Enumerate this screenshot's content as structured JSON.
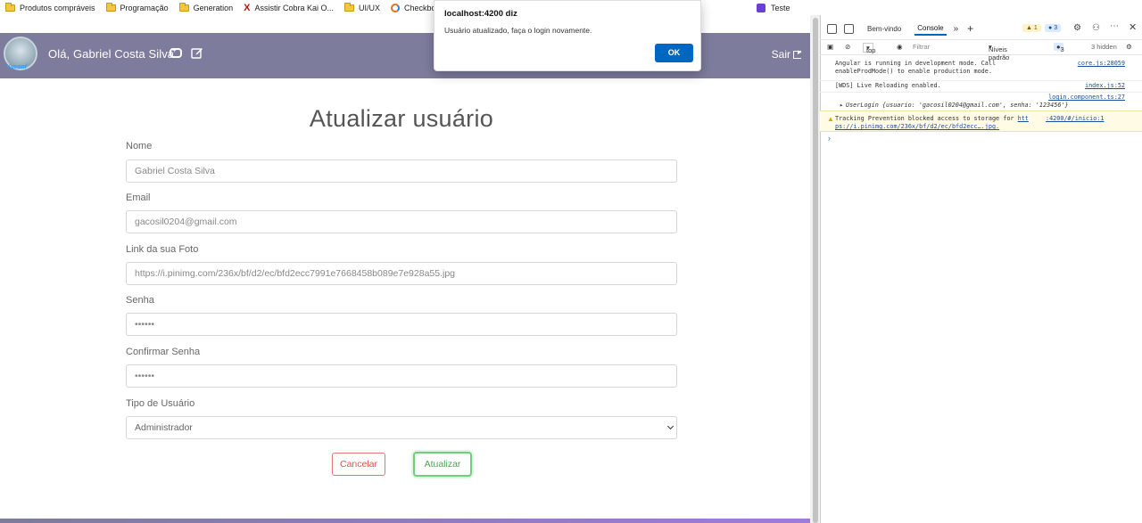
{
  "bookmarks": [
    {
      "label": "Produtos compráveis",
      "icon": "folder-icon"
    },
    {
      "label": "Programação",
      "icon": "folder-icon"
    },
    {
      "label": "Generation",
      "icon": "folder-icon"
    },
    {
      "label": "Assistir Cobra Kai O...",
      "icon": "x-site-icon"
    },
    {
      "label": "UI/UX",
      "icon": "folder-icon"
    },
    {
      "label": "Checkbox HTML: co...",
      "icon": "codepen-icon"
    },
    {
      "label": "Teste",
      "icon": "app-icon"
    }
  ],
  "navbar": {
    "greeting": "Olá, Gabriel Costa Silva",
    "logout": "Sair",
    "avatar_tag": "Yaconf"
  },
  "form": {
    "title": "Atualizar usuário",
    "name_label": "Nome",
    "name_value": "Gabriel Costa Silva",
    "email_label": "Email",
    "email_value": "gacosil0204@gmail.com",
    "photo_label": "Link da sua Foto",
    "photo_value": "https://i.pinimg.com/236x/bf/d2/ec/bfd2ecc7991e7668458b089e7e928a55.jpg",
    "password_label": "Senha",
    "password_value": "••••••",
    "confirm_label": "Confirmar Senha",
    "confirm_value": "••••••",
    "type_label": "Tipo de Usuário",
    "type_value": "Administrador",
    "cancel": "Cancelar",
    "update": "Atualizar"
  },
  "dialog": {
    "title": "localhost:4200 diz",
    "message": "Usuário atualizado, faça o login novamente.",
    "ok": "OK"
  },
  "devtools": {
    "tab_welcome": "Bem-vindo",
    "tab_console": "Console",
    "warn_count": "1",
    "info_count": "3",
    "context": "top",
    "filter_placeholder": "Filtrar",
    "levels": "Níveis padrão",
    "levels_count": "3",
    "hidden": "3 hidden",
    "lines": {
      "l1a": "Angular is running in development mode. Call",
      "l1b": "enableProdMode() to enable production mode.",
      "l1_src": "core.js:28059",
      "l2": "[WDS] Live Reloading enabled.",
      "l2_src": "index.js:52",
      "l3_src": "login.component.ts:27",
      "l3": "UserLogin {usuario: 'gacosil0204@gmail.com', senha: '123456'}",
      "warn_a": "Tracking Prevention blocked access to storage for",
      "warn_link1": "htt",
      "warn_src": ":4200/#/inicio:1",
      "warn_b": "ps://i.pinimg.com/236x/bf/d2/ec/bfd2ecc….jpg."
    }
  }
}
